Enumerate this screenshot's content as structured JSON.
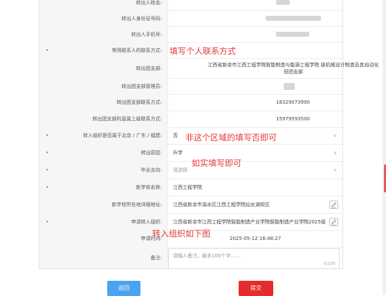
{
  "form": {
    "rows": [
      {
        "key": "transfer_out_person",
        "label": "转出人姓名:",
        "value": "",
        "required": false
      },
      {
        "key": "id_number",
        "label": "转出人身份证号码:",
        "value": "",
        "required": false
      },
      {
        "key": "phone",
        "label": "转出人手机号:",
        "value": "",
        "required": false
      },
      {
        "key": "contact",
        "label": "常用联系人的联系方式:",
        "value": "",
        "required": true
      },
      {
        "key": "branch",
        "label": "转出团支部:",
        "value": "江西省新余市江西工程学院智能制造与能源工程学院  级机械设计制造及其自动化  班团支部",
        "required": false
      },
      {
        "key": "branch_manager",
        "label": "转出团支部管理员:",
        "value": "",
        "required": false
      },
      {
        "key": "branch_contact",
        "label": "转出团支部联系方式:",
        "value": "18329073990",
        "required": false
      },
      {
        "key": "superior_contact",
        "label": "转出团支部的直属上级联系方式:",
        "value": "15979593500",
        "required": false
      },
      {
        "key": "region",
        "label": "转入组织是否属于北京 / 广东 / 福建:",
        "value": "否",
        "required": true
      },
      {
        "key": "reason",
        "label": "转出原因:",
        "value": "升学",
        "required": true
      },
      {
        "key": "destination",
        "label": "毕业去向:",
        "value": "请选择",
        "required": true
      },
      {
        "key": "new_school",
        "label": "新学校名称:",
        "value": "江西工程学院",
        "required": true
      },
      {
        "key": "new_school_address",
        "label": "新学校所在地详细地址:",
        "value": "江西省新余市渝水区江西工程学院仙女湖校区",
        "required": false
      },
      {
        "key": "target_org",
        "label": "申请转入组织:",
        "value": "江西省新余市江西工程学院智能制造产业学院智能制造产业学院2025级",
        "required": true
      },
      {
        "key": "apply_time",
        "label": "申请时间:",
        "value": "2025-05-12 16:48:27",
        "required": false
      },
      {
        "key": "remark",
        "label": "备注:",
        "placeholder": "请输入备注，最多100个字……",
        "counter": "0/100",
        "required": false
      }
    ]
  },
  "annotations": {
    "contact_note": "填写个人联系方式",
    "region_note": "非这个区域的填写否即可",
    "destination_note": "如实填写即可",
    "org_note": "转入组织如下图"
  },
  "buttons": {
    "back": "返回",
    "submit": "提交"
  },
  "colors": {
    "annotation": "#e53935",
    "back_button": "#4aa3f0",
    "submit_button": "#e52b2b",
    "required_marker": "#e05b5b"
  }
}
